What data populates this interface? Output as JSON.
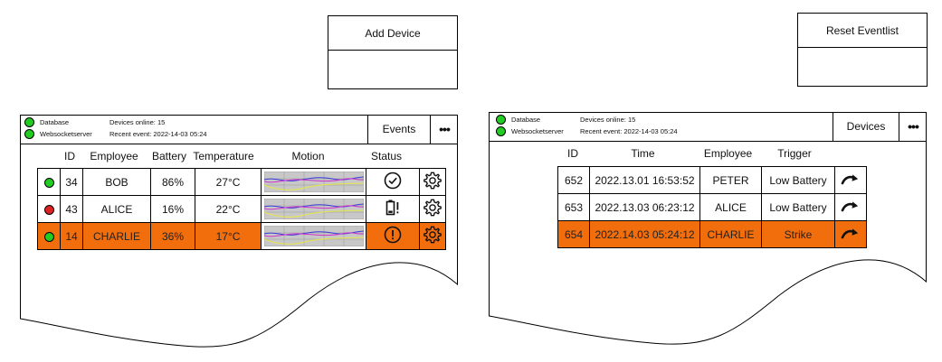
{
  "buttons": {
    "add_device": "Add Device",
    "reset_eventlist": "Reset Eventlist"
  },
  "status": {
    "database_label": "Database",
    "websocket_label": "Websocketserver",
    "devices_online": "Devices online: 15",
    "recent_event": "Recent event: 2022-14-03 05:24"
  },
  "devices_panel": {
    "nav_label": "Events",
    "more": "•••",
    "columns": [
      "",
      "ID",
      "Employee",
      "Battery",
      "Temperature",
      "Motion",
      "Status",
      ""
    ],
    "rows": [
      {
        "online": "green",
        "id": "34",
        "employee": "BOB",
        "battery": "86%",
        "temperature": "27°C",
        "status_icon": "check-circle-icon"
      },
      {
        "online": "red",
        "id": "43",
        "employee": "ALICE",
        "battery": "16%",
        "temperature": "22°C",
        "status_icon": "low-battery-icon"
      },
      {
        "online": "green",
        "id": "14",
        "employee": "CHARLIE",
        "battery": "36%",
        "temperature": "17°C",
        "status_icon": "alert-circle-icon"
      }
    ],
    "highlight_row": 2
  },
  "events_panel": {
    "nav_label": "Devices",
    "more": "•••",
    "columns": [
      "ID",
      "Time",
      "Employee",
      "Trigger",
      ""
    ],
    "rows": [
      {
        "id": "652",
        "time": "2022.13.01 16:53:52",
        "employee": "PETER",
        "trigger": "Low Battery"
      },
      {
        "id": "653",
        "time": "2022.13.03 06:23:12",
        "employee": "ALICE",
        "trigger": "Low Battery"
      },
      {
        "id": "654",
        "time": "2022.14.03 05:24:12",
        "employee": "CHARLIE",
        "trigger": "Strike"
      }
    ],
    "highlight_row": 2
  },
  "colors": {
    "highlight": "#f26e0d",
    "online": "#22cc22",
    "offline": "#dd2222"
  }
}
